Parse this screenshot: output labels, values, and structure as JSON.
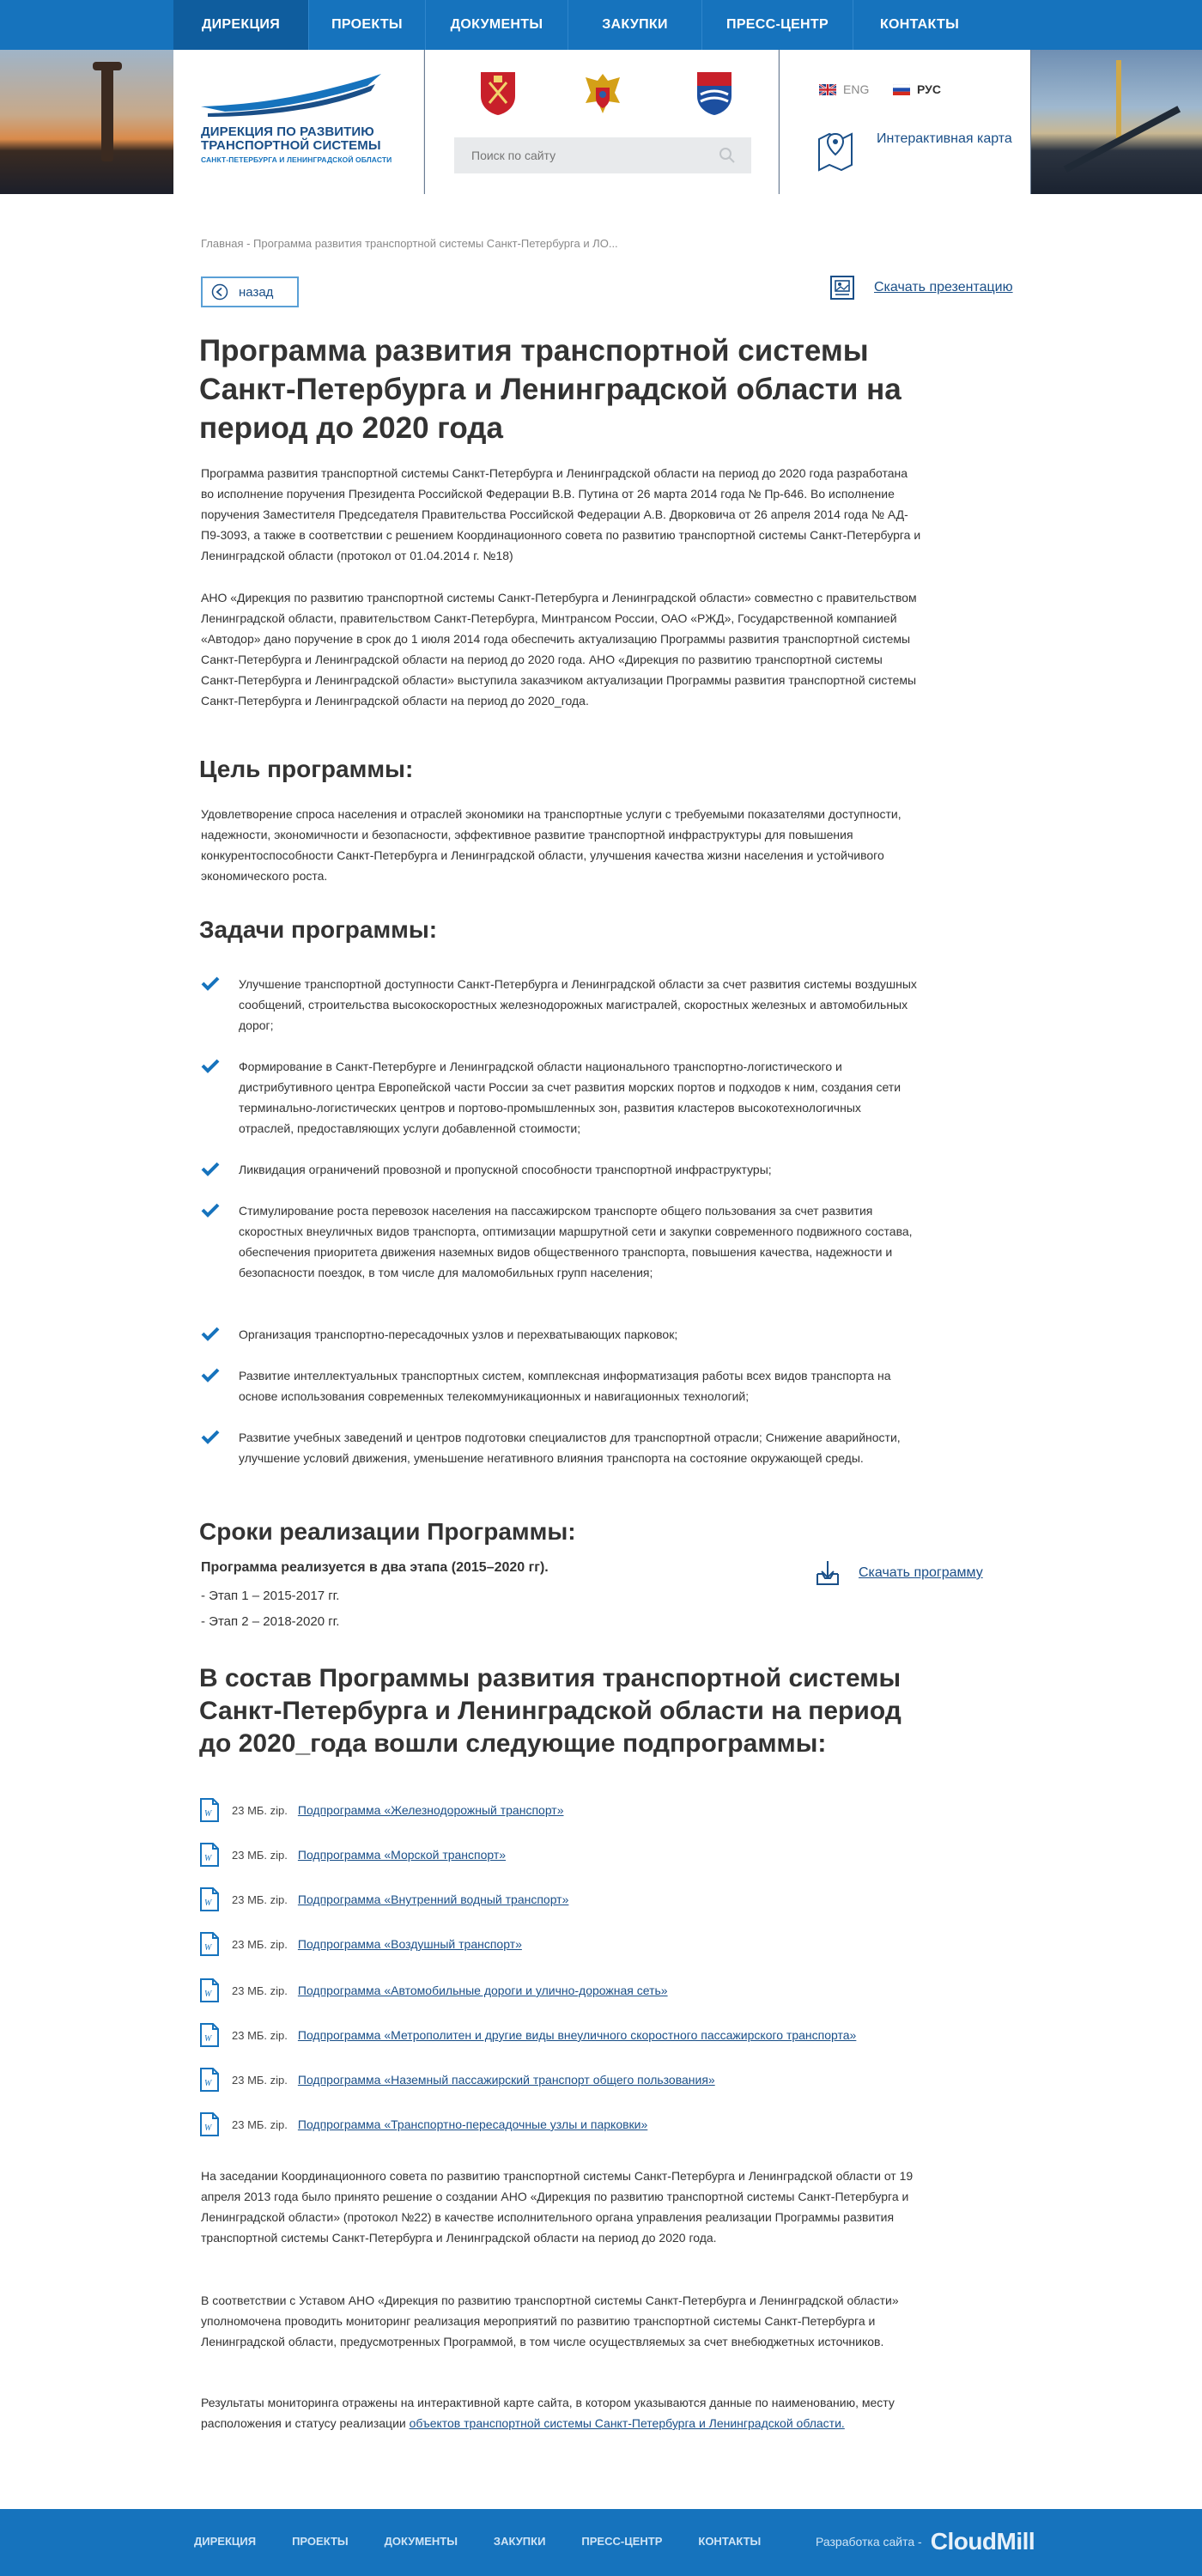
{
  "nav": {
    "items": [
      {
        "label": "ДИРЕКЦИЯ",
        "active": true
      },
      {
        "label": "ПРОЕКТЫ",
        "active": false
      },
      {
        "label": "ДОКУМЕНТЫ",
        "active": false
      },
      {
        "label": "ЗАКУПКИ",
        "active": false
      },
      {
        "label": "ПРЕСС-ЦЕНТР",
        "active": false
      },
      {
        "label": "КОНТАКТЫ",
        "active": false
      }
    ]
  },
  "logo": {
    "line1": "ДИРЕКЦИЯ ПО РАЗВИТИЮ",
    "line2": "ТРАНСПОРТНОЙ СИСТЕМЫ",
    "line3": "САНКТ-ПЕТЕРБУРГА И ЛЕНИНГРАДСКОЙ ОБЛАСТИ"
  },
  "search": {
    "placeholder": "Поиск по сайту"
  },
  "lang": {
    "eng": "ENG",
    "rus": "РУС"
  },
  "map": {
    "label": "Интерактивная карта"
  },
  "breadcrumb": "Главная - Программа развития транспортной системы Санкт-Петербурга и ЛО...",
  "back_label": "назад",
  "download_presentation": "Скачать презентацию",
  "title": "Программа развития транспортной системы Санкт-Петербурга и Ленинградской области на период до 2020 года",
  "intro": [
    "Программа развития транспортной системы Санкт-Петербурга и Ленинградской области на период до 2020 года разработана во исполнение поручения Президента Российской Федерации В.В. Путина от 26 марта 2014 года  № Пр-646. Во исполнение поручения Заместителя Председателя Правительства Российской Федерации А.В. Дворковича от 26 апреля 2014 года № АД-П9-3093, а также в соответствии с решением Координационного совета по развитию транспортной системы Санкт-Петербурга и Ленинградской области (протокол от 01.04.2014 г. №18)",
    "АНО «Дирекция по развитию транспортной системы Санкт-Петербурга и Ленинградской области» совместно с правительством Ленинградской области, правительством Санкт-Петербурга, Минтрансом России, ОАО «РЖД», Государственной компанией «Автодор» дано поручение в срок до 1 июля 2014 года обеспечить актуализацию Программы развития транспортной системы Санкт-Петербурга и Ленинградской области на период до 2020 года. АНО «Дирекция по развитию транспортной системы Санкт-Петербурга и Ленинградской области» выступила заказчиком актуализации Программы развития транспортной системы Санкт-Петербурга и Ленинградской области на период до 2020_года."
  ],
  "goal": {
    "heading": "Цель программы:",
    "text": "Удовлетворение спроса населения и отраслей экономики на транспортные услуги с требуемыми показателями доступности,  надежности, экономичности и  безопасности, эффективное развитие транспортной инфраструктуры для повышения конкурентоспособности Санкт-Петербурга и Ленинградской области,  улучшения качества жизни населения и устойчивого экономического роста."
  },
  "tasks": {
    "heading": "Задачи программы:",
    "items": [
      "Улучшение транспортной доступности Санкт-Петербурга и  Ленинградской области за счет развития системы воздушных сообщений, строительства высокоскоростных железнодорожных магистралей, скоростных железных и автомобильных дорог;",
      "Формирование в Санкт-Петербурге и Ленинградской области национального транспортно-логистического и дистрибутивного центра Европейской части России за счет развития морских портов и подходов к ним, создания сети терминально-логистических центров и портово-промышленных зон, развития кластеров высокотехнологичных отраслей, предоставляющих  услуги добавленной стоимости;",
      "Ликвидация ограничений провозной и пропускной способности транспортной инфраструктуры;",
      "Стимулирование роста перевозок населения на пассажирском транспорте общего пользования за счет развития скоростных внеуличных видов транспорта, оптимизации маршрутной сети и закупки современного подвижного состава, обеспечения приоритета движения наземных видов общественного транспорта, повышения качества, надежности и безопасности поездок, в том числе для маломобильных групп населения;",
      "Организация транспортно-пересадочных узлов и перехватывающих  парковок;",
      "Развитие интеллектуальных  транспортных систем, комплексная информатизация работы всех видов транспорта на основе использования современных телекоммуникационных и навигационных технологий;",
      "Развитие  учебных заведений и центров подготовки специалистов для транспортной  отрасли; Снижение аварийности, улучшение условий движения,  уменьшение негативного влияния транспорта на состояние окружающей среды."
    ]
  },
  "terms": {
    "heading": "Сроки реализации Программы:",
    "stages_title": "Программа реализуется в два этапа (2015–2020 гг).",
    "stage1": "-  Этап 1 – 2015-2017 гг.",
    "stage2": " - Этап 2 – 2018-2020 гг.",
    "download_program": "Скачать программу"
  },
  "subprograms": {
    "heading": "В состав Программы развития транспортной системы Санкт-Петербурга и Ленинградской области на период до 2020_года вошли следующие подпрограммы:",
    "files": [
      {
        "size": "23 МБ. zip.",
        "title": "Подпрограмма «Железнодорожный транспорт»"
      },
      {
        "size": "23 МБ. zip.",
        "title": "Подпрограмма «Морской транспорт»"
      },
      {
        "size": "23 МБ. zip.",
        "title": "Подпрограмма «Внутренний водный транспорт»"
      },
      {
        "size": "23 МБ. zip.",
        "title": "Подпрограмма «Воздушный транспорт»"
      },
      {
        "size": "23 МБ. zip.",
        "title": "Подпрограмма «Автомобильные дороги и улично-дорожная сеть»"
      },
      {
        "size": "23 МБ. zip.",
        "title": "Подпрограмма «Метрополитен и другие виды внеуличного скоростного пассажирского  транспорта»"
      },
      {
        "size": "23 МБ. zip.",
        "title": "Подпрограмма «Наземный пассажирский транспорт общего пользования»"
      },
      {
        "size": "23 МБ. zip.",
        "title": "Подпрограмма «Транспортно-пересадочные узлы и парковки»"
      }
    ]
  },
  "closing": {
    "p1": "На заседании Координационного совета по развитию транспортной системы Санкт-Петербурга и Ленинградской области от 19 апреля 2013 года было принято решение о создании АНО «Дирекция по развитию транспортной системы Санкт-Петербурга и Ленинградской области» (протокол №22) в качестве исполнительного органа управления реализации Программы развития транспортной системы Санкт-Петербурга и Ленинградской области на период до 2020 года.",
    "p2": "В соответствии с Уставом АНО «Дирекция по развитию транспортной системы Санкт-Петербурга и Ленинградской области» уполномочена проводить мониторинг реализация мероприятий по развитию транспортной системы Санкт-Петербурга и Ленинградской области, предусмотренных Программой, в том числе осуществляемых за счет внебюджетных источников.",
    "p3_text": "Результаты мониторинга отражены на интерактивной карте сайта, в котором  указываются данные по наименованию, месту расположения и статусу реализации ",
    "p3_link": "объектов транспортной системы Санкт-Петербурга и Ленинградской области. "
  },
  "footer": {
    "items": [
      "ДИРЕКЦИЯ",
      "ПРОЕКТЫ",
      "ДОКУМЕНТЫ",
      "ЗАКУПКИ",
      "ПРЕСС-ЦЕНТР",
      "КОНТАКТЫ"
    ],
    "developer_label": "Разработка сайта -",
    "developer_brand": "CloudMill"
  },
  "colors": {
    "primary": "#1673bd",
    "active_nav": "#0f5d9e",
    "link": "#1a4f88"
  },
  "icons": {
    "back": "arrow-left-circle-icon",
    "presentation": "presentation-icon",
    "map": "map-pin-icon",
    "check": "checkmark-icon",
    "download": "download-tray-icon",
    "file": "word-document-icon",
    "search": "search-icon"
  }
}
